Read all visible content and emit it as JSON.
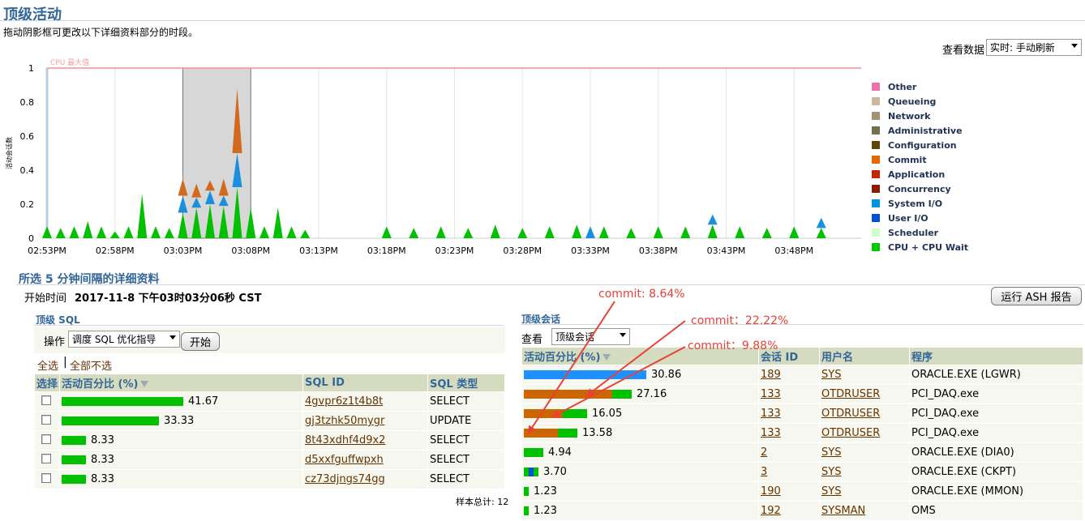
{
  "page": {
    "title": "顶级活动",
    "instruction": "拖动阴影框可更改以下详细资料部分的时段。"
  },
  "view_data": {
    "label": "查看数据",
    "selected": "实时: 手动刷新"
  },
  "chart_data": {
    "type": "area",
    "stacked": true,
    "max_line_label": "CPU 最大值",
    "ylabel": "活动会话数",
    "ylim": [
      0,
      1
    ],
    "yticks": [
      "1",
      "0.8",
      "0.6",
      "0.4",
      "0.2",
      "0"
    ],
    "xticks": [
      "02:53PM",
      "02:58PM",
      "03:03PM",
      "03:08PM",
      "03:13PM",
      "03:18PM",
      "03:23PM",
      "03:28PM",
      "03:33PM",
      "03:38PM",
      "03:43PM",
      "03:48PM"
    ],
    "selection": {
      "start": "03:03PM",
      "end": "03:08PM"
    },
    "series": [
      {
        "name": "CPU + CPU Wait",
        "color": "#00c000",
        "points": [
          [
            "02:53PM",
            0.07
          ],
          [
            "02:54PM",
            0.06
          ],
          [
            "02:55PM",
            0.07
          ],
          [
            "02:56PM",
            0.1
          ],
          [
            "02:57PM",
            0.07
          ],
          [
            "02:58PM",
            0.04
          ],
          [
            "02:59PM",
            0.07
          ],
          [
            "03:00PM",
            0.26
          ],
          [
            "03:01PM",
            0.07
          ],
          [
            "03:02PM",
            0.06
          ],
          [
            "03:03PM",
            0.15
          ],
          [
            "03:04PM",
            0.18
          ],
          [
            "03:05PM",
            0.2
          ],
          [
            "03:06PM",
            0.19
          ],
          [
            "03:07PM",
            0.3
          ],
          [
            "03:08PM",
            0.18
          ],
          [
            "03:09PM",
            0.07
          ],
          [
            "03:10PM",
            0.18
          ],
          [
            "03:11PM",
            0.07
          ],
          [
            "03:12PM",
            0.05
          ],
          [
            "03:18PM",
            0.07
          ],
          [
            "03:20PM",
            0.06
          ],
          [
            "03:22PM",
            0.07
          ],
          [
            "03:24PM",
            0.06
          ],
          [
            "03:26PM",
            0.08
          ],
          [
            "03:28PM",
            0.06
          ],
          [
            "03:30PM",
            0.07
          ],
          [
            "03:32PM",
            0.08
          ],
          [
            "03:34PM",
            0.07
          ],
          [
            "03:36PM",
            0.06
          ],
          [
            "03:38PM",
            0.07
          ],
          [
            "03:40PM",
            0.07
          ],
          [
            "03:42PM",
            0.08
          ],
          [
            "03:44PM",
            0.07
          ],
          [
            "03:46PM",
            0.06
          ],
          [
            "03:48PM",
            0.07
          ],
          [
            "03:50PM",
            0.06
          ]
        ]
      },
      {
        "name": "System I/O",
        "color": "#1a8fdd",
        "points": [
          [
            "02:53PM",
            0.0
          ],
          [
            "03:03PM",
            0.1
          ],
          [
            "03:04PM",
            0.06
          ],
          [
            "03:05PM",
            0.08
          ],
          [
            "03:06PM",
            0.06
          ],
          [
            "03:07PM",
            0.2
          ],
          [
            "03:08PM",
            0.0
          ],
          [
            "03:33PM",
            0.07
          ],
          [
            "03:42PM",
            0.06
          ],
          [
            "03:50PM",
            0.06
          ]
        ]
      },
      {
        "name": "Commit",
        "color": "#d2691e",
        "points": [
          [
            "02:53PM",
            0.0
          ],
          [
            "03:03PM",
            0.1
          ],
          [
            "03:04PM",
            0.08
          ],
          [
            "03:05PM",
            0.06
          ],
          [
            "03:06PM",
            0.1
          ],
          [
            "03:07PM",
            0.38
          ],
          [
            "03:08PM",
            0.0
          ]
        ]
      }
    ],
    "legend": [
      {
        "label": "Other",
        "color": "#f06eaa"
      },
      {
        "label": "Queueing",
        "color": "#c8b99a"
      },
      {
        "label": "Network",
        "color": "#9f9371"
      },
      {
        "label": "Administrative",
        "color": "#707050"
      },
      {
        "label": "Configuration",
        "color": "#5c440b"
      },
      {
        "label": "Commit",
        "color": "#e46800"
      },
      {
        "label": "Application",
        "color": "#c02800"
      },
      {
        "label": "Concurrency",
        "color": "#8b1a00"
      },
      {
        "label": "System I/O",
        "color": "#0093e0"
      },
      {
        "label": "User I/O",
        "color": "#0252d4"
      },
      {
        "label": "Scheduler",
        "color": "#ccffcc"
      },
      {
        "label": "CPU + CPU Wait",
        "color": "#00cc00"
      }
    ]
  },
  "detail": {
    "title": "所选 5 分钟间隔的详细资料",
    "start_label": "开始时间",
    "start_value": "2017-11-8 下午03时03分06秒 CST",
    "run_ash_button": "运行 ASH 报告"
  },
  "top_sql": {
    "title": "顶级 SQL",
    "action_label": "操作",
    "action_selected": "调度 SQL 优化指导",
    "go_button": "开始",
    "select_all": "全选",
    "select_none": "全部不选",
    "columns": [
      "选择",
      "活动百分比 (%)",
      "SQL ID",
      "SQL 类型"
    ],
    "rows": [
      {
        "pct": "41.67",
        "sql_id": "4gvpr6z1t4b8t",
        "type": "SELECT",
        "share": 41.67
      },
      {
        "pct": "33.33",
        "sql_id": "gj3tzhk50mygr",
        "type": "UPDATE",
        "share": 33.33
      },
      {
        "pct": "8.33",
        "sql_id": "8t43xdhf4d9x2",
        "type": "SELECT",
        "share": 8.33
      },
      {
        "pct": "8.33",
        "sql_id": "d5xxfguffwpxh",
        "type": "SELECT",
        "share": 8.33
      },
      {
        "pct": "8.33",
        "sql_id": "cz73djngs74gg",
        "type": "SELECT",
        "share": 8.33
      }
    ],
    "sample_total": "样本总计: 12"
  },
  "top_sessions": {
    "title": "顶级会话",
    "view_label": "查看",
    "view_selected": "顶级会话",
    "columns": [
      "活动百分比 (%)",
      "会话 ID",
      "用户名",
      "程序"
    ],
    "rows": [
      {
        "pct": "30.86",
        "sid": "189",
        "user": "SYS",
        "program": "ORACLE.EXE (LGWR)",
        "segments": [
          {
            "color": "#1e90ff",
            "share": 30.86
          }
        ]
      },
      {
        "pct": "27.16",
        "sid": "133",
        "user": "OTDRUSER",
        "program": "PCI_DAQ.exe",
        "segments": [
          {
            "color": "#cc6600",
            "share": 22.22
          },
          {
            "color": "#00c000",
            "share": 4.94
          }
        ]
      },
      {
        "pct": "16.05",
        "sid": "133",
        "user": "OTDRUSER",
        "program": "PCI_DAQ.exe",
        "segments": [
          {
            "color": "#cc6600",
            "share": 9.88
          },
          {
            "color": "#00c000",
            "share": 6.17
          }
        ]
      },
      {
        "pct": "13.58",
        "sid": "133",
        "user": "OTDRUSER",
        "program": "PCI_DAQ.exe",
        "segments": [
          {
            "color": "#cc6600",
            "share": 8.64
          },
          {
            "color": "#00c000",
            "share": 4.94
          }
        ]
      },
      {
        "pct": "4.94",
        "sid": "2",
        "user": "SYS",
        "program": "ORACLE.EXE (DIA0)",
        "segments": [
          {
            "color": "#00c000",
            "share": 4.94
          }
        ]
      },
      {
        "pct": "3.70",
        "sid": "3",
        "user": "SYS",
        "program": "ORACLE.EXE (CKPT)",
        "segments": [
          {
            "color": "#00c000",
            "share": 1.23
          },
          {
            "color": "#0252d4",
            "share": 1.23
          },
          {
            "color": "#00c000",
            "share": 1.24
          }
        ]
      },
      {
        "pct": "1.23",
        "sid": "190",
        "user": "SYS",
        "program": "ORACLE.EXE (MMON)",
        "segments": [
          {
            "color": "#00c000",
            "share": 1.23
          }
        ]
      },
      {
        "pct": "1.23",
        "sid": "192",
        "user": "SYSMAN",
        "program": "OMS",
        "segments": [
          {
            "color": "#00c000",
            "share": 1.23
          }
        ]
      }
    ]
  },
  "annotations": [
    {
      "text": "commit: 8.64%"
    },
    {
      "text": "commit：22.22%"
    },
    {
      "text": "commit：9.88%"
    }
  ]
}
